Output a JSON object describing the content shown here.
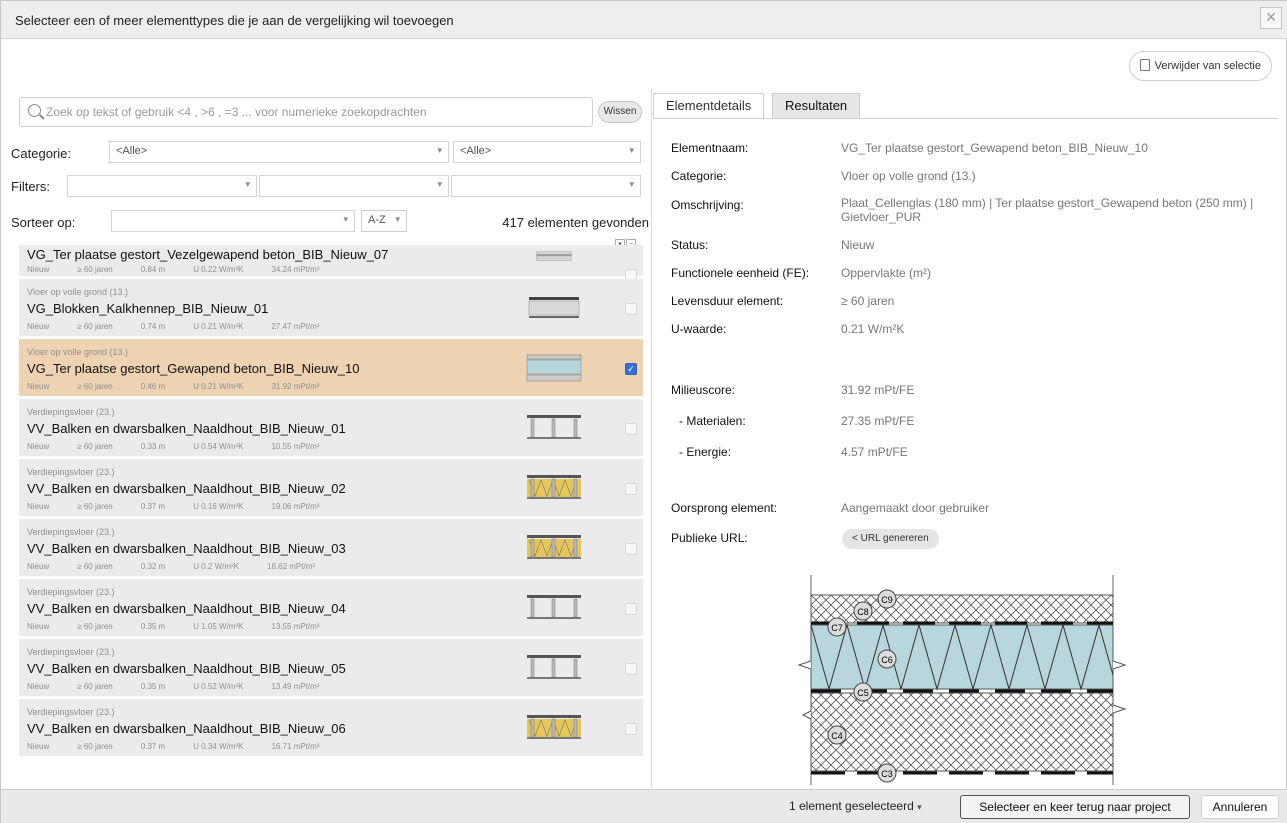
{
  "dialog": {
    "title": "Selecteer een of meer elementtypes die je aan de vergelijking wil toevoegen",
    "close_icon": "close-icon",
    "remove_selection_label": "Verwijder van selectie"
  },
  "search": {
    "placeholder": "Zoek op tekst of gebruik <4 , >6 , =3 ... voor numerieke zoekopdrachten",
    "value": "",
    "clear_label": "Wissen"
  },
  "filters": {
    "category_label": "Categorie:",
    "category_value_1": "<Alle>",
    "category_value_2": "<Alle>",
    "filters_label": "Filters:",
    "sort_label": "Sorteer op:",
    "sort_value": "",
    "sort_order": "A-Z",
    "results_count": "417 elementen gevonden"
  },
  "elements": [
    {
      "category": "",
      "name": "VG_Ter plaatse gestort_Vezelgewapend beton_BIB_Nieuw_07",
      "status": "Nieuw",
      "life": "≥ 60 jaren",
      "thickness": "0.84 m",
      "u": "U 0.22 W/m²K",
      "score": "34.24 mPt/m²",
      "selected": false
    },
    {
      "category": "Vloer op volle grond (13.)",
      "name": "VG_Blokken_Kalkhennep_BIB_Nieuw_01",
      "status": "Nieuw",
      "life": "≥ 60 jaren",
      "thickness": "0.74 m",
      "u": "U 0.21 W/m²K",
      "score": "27.47 mPt/m²",
      "selected": false
    },
    {
      "category": "Vloer op volle grond (13.)",
      "name": "VG_Ter plaatse gestort_Gewapend beton_BIB_Nieuw_10",
      "status": "Nieuw",
      "life": "≥ 60 jaren",
      "thickness": "0.46 m",
      "u": "U 0.21 W/m²K",
      "score": "31.92 mPt/m²",
      "selected": true
    },
    {
      "category": "Verdiepingsvloer (23.)",
      "name": "VV_Balken en dwarsbalken_Naaldhout_BIB_Nieuw_01",
      "status": "Nieuw",
      "life": "≥ 60 jaren",
      "thickness": "0.33 m",
      "u": "U 0.54 W/m²K",
      "score": "10.55 mPt/m²",
      "selected": false
    },
    {
      "category": "Verdiepingsvloer (23.)",
      "name": "VV_Balken en dwarsbalken_Naaldhout_BIB_Nieuw_02",
      "status": "Nieuw",
      "life": "≥ 60 jaren",
      "thickness": "0.37 m",
      "u": "U 0.16 W/m²K",
      "score": "19.06 mPt/m²",
      "selected": false
    },
    {
      "category": "Verdiepingsvloer (23.)",
      "name": "VV_Balken en dwarsbalken_Naaldhout_BIB_Nieuw_03",
      "status": "Nieuw",
      "life": "≥ 60 jaren",
      "thickness": "0.32 m",
      "u": "U 0.2 W/m²K",
      "score": "18.62 mPt/m²",
      "selected": false
    },
    {
      "category": "Verdiepingsvloer (23.)",
      "name": "VV_Balken en dwarsbalken_Naaldhout_BIB_Nieuw_04",
      "status": "Nieuw",
      "life": "≥ 60 jaren",
      "thickness": "0.35 m",
      "u": "U 1.05 W/m²K",
      "score": "13.55 mPt/m²",
      "selected": false
    },
    {
      "category": "Verdiepingsvloer (23.)",
      "name": "VV_Balken en dwarsbalken_Naaldhout_BIB_Nieuw_05",
      "status": "Nieuw",
      "life": "≥ 60 jaren",
      "thickness": "0.35 m",
      "u": "U 0.52 W/m²K",
      "score": "13.49 mPt/m²",
      "selected": false
    },
    {
      "category": "Verdiepingsvloer (23.)",
      "name": "VV_Balken en dwarsbalken_Naaldhout_BIB_Nieuw_06",
      "status": "Nieuw",
      "life": "≥ 60 jaren",
      "thickness": "0.37 m",
      "u": "U 0.34 W/m²K",
      "score": "16.71 mPt/m²",
      "selected": false
    }
  ],
  "tabs": {
    "details": "Elementdetails",
    "results": "Resultaten"
  },
  "details": {
    "name_label": "Elementnaam:",
    "name_value": "VG_Ter plaatse gestort_Gewapend beton_BIB_Nieuw_10",
    "category_label": "Categorie:",
    "category_value": "Vloer op volle grond (13.)",
    "description_label": "Omschrijving:",
    "description_value": "Plaat_Cellenglas (180 mm) | Ter plaatse gestort_Gewapend beton (250 mm) | Gietvloer_PUR",
    "status_label": "Status:",
    "status_value": "Nieuw",
    "fe_label": "Functionele eenheid (FE):",
    "fe_value": "Oppervlakte (m²)",
    "life_label": "Levensduur element:",
    "life_value": "≥ 60 jaren",
    "u_label": "U-waarde:",
    "u_value": "0.21 W/m²K",
    "env_label": "Milieuscore:",
    "env_value": "31.92 mPt/FE",
    "mat_label": "- Materialen:",
    "mat_value": "27.35 mPt/FE",
    "energy_label": "- Energie:",
    "energy_value": "4.57 mPt/FE",
    "origin_label": "Oorsprong element:",
    "origin_value": "Aangemaakt door gebruiker",
    "url_label": "Publieke URL:",
    "url_button": "URL genereren"
  },
  "diagram_labels": [
    "C9",
    "C8",
    "C7",
    "C6",
    "C5",
    "C4",
    "C3"
  ],
  "colors": {
    "selected_row": "#edd3b2",
    "insulation": "#b8d7dd",
    "checkbox_checked": "#3a70d6"
  },
  "footer": {
    "selected_count": "1 element geselecteerd",
    "confirm_label": "Selecteer en keer terug naar project",
    "cancel_label": "Annuleren"
  }
}
